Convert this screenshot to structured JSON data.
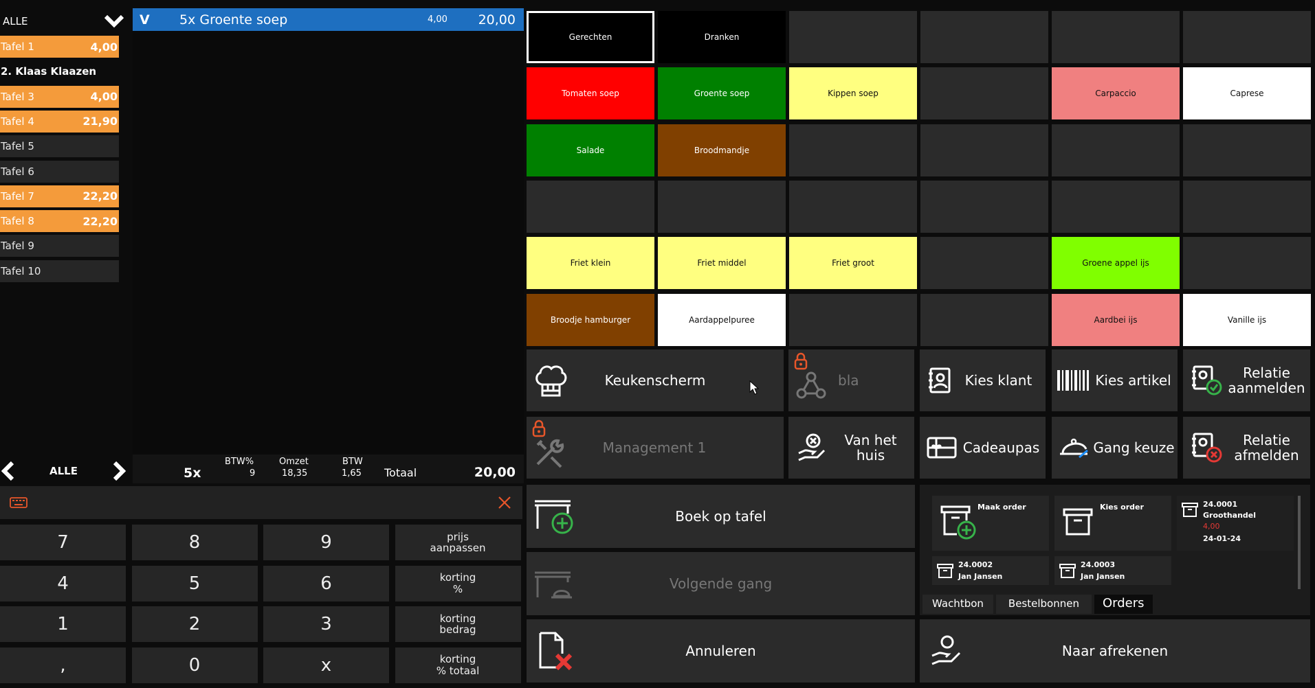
{
  "tables": {
    "filter_label": "ALLE",
    "items": [
      {
        "name": "Tafel 1",
        "amount": "4,00",
        "state": "busy"
      },
      {
        "name": "2. Klaas Klaazen",
        "amount": "",
        "state": "bold"
      },
      {
        "name": "Tafel 3",
        "amount": "4,00",
        "state": "busy"
      },
      {
        "name": "Tafel 4",
        "amount": "21,90",
        "state": "busy"
      },
      {
        "name": "Tafel 5",
        "amount": "",
        "state": "free"
      },
      {
        "name": "Tafel 6",
        "amount": "",
        "state": "free"
      },
      {
        "name": "Tafel 7",
        "amount": "22,20",
        "state": "busy"
      },
      {
        "name": "Tafel 8",
        "amount": "22,20",
        "state": "busy"
      },
      {
        "name": "Tafel 9",
        "amount": "",
        "state": "free"
      },
      {
        "name": "Tafel 10",
        "amount": "",
        "state": "free"
      }
    ],
    "pager_label": "ALLE"
  },
  "order": {
    "line": {
      "flag": "V",
      "text": "5x Groente soep",
      "unit": "4,00",
      "total": "20,00"
    },
    "summary": {
      "count": "5x",
      "btw_pct_label": "BTW%",
      "btw_pct": "9",
      "omzet_label": "Omzet",
      "omzet": "18,35",
      "btw_label": "BTW",
      "btw": "1,65",
      "totaal_label": "Totaal",
      "totaal": "20,00"
    }
  },
  "keypad": {
    "keys": [
      "7",
      "8",
      "9",
      "4",
      "5",
      "6",
      "1",
      "2",
      "3",
      ",",
      "0",
      "x"
    ],
    "side": [
      "prijs\naanpassen",
      "korting\n%",
      "korting\nbedrag",
      "korting\n% totaal"
    ]
  },
  "products": [
    {
      "label": "Gerechten",
      "color": "#000000"
    },
    {
      "label": "Dranken",
      "color": "#000000"
    },
    {
      "label": "",
      "color": "#2b2b2b"
    },
    {
      "label": "",
      "color": "#2b2b2b"
    },
    {
      "label": "",
      "color": "#2b2b2b"
    },
    {
      "label": "",
      "color": "#2b2b2b"
    },
    {
      "label": "Tomaten soep",
      "color": "#ff0000"
    },
    {
      "label": "Groente soep",
      "color": "#008000"
    },
    {
      "label": "Kippen soep",
      "color": "#ffff80"
    },
    {
      "label": "",
      "color": "#2b2b2b"
    },
    {
      "label": "Carpaccio",
      "color": "#f08080"
    },
    {
      "label": "Caprese",
      "color": "#ffffff"
    },
    {
      "label": "Salade",
      "color": "#008000"
    },
    {
      "label": "Broodmandje",
      "color": "#804000"
    },
    {
      "label": "",
      "color": "#2b2b2b"
    },
    {
      "label": "",
      "color": "#2b2b2b"
    },
    {
      "label": "",
      "color": "#2b2b2b"
    },
    {
      "label": "",
      "color": "#2b2b2b"
    },
    {
      "label": "",
      "color": "#2b2b2b"
    },
    {
      "label": "",
      "color": "#2b2b2b"
    },
    {
      "label": "",
      "color": "#2b2b2b"
    },
    {
      "label": "",
      "color": "#2b2b2b"
    },
    {
      "label": "",
      "color": "#2b2b2b"
    },
    {
      "label": "",
      "color": "#2b2b2b"
    },
    {
      "label": "Friet klein",
      "color": "#ffff80"
    },
    {
      "label": "Friet middel",
      "color": "#ffff80"
    },
    {
      "label": "Friet groot",
      "color": "#ffff80"
    },
    {
      "label": "",
      "color": "#2b2b2b"
    },
    {
      "label": "Groene appel ijs",
      "color": "#80ff00"
    },
    {
      "label": "",
      "color": "#2b2b2b"
    },
    {
      "label": "Broodje hamburger",
      "color": "#804000"
    },
    {
      "label": "Aardappelpuree",
      "color": "#ffffff"
    },
    {
      "label": "",
      "color": "#2b2b2b"
    },
    {
      "label": "",
      "color": "#2b2b2b"
    },
    {
      "label": "Aardbei ijs",
      "color": "#f08080"
    },
    {
      "label": "Vanille ijs",
      "color": "#ffffff"
    }
  ],
  "actions": {
    "keukenscherm": "Keukenscherm",
    "bla": "bla",
    "kies_klant": "Kies klant",
    "kies_artikel": "Kies artikel",
    "relatie_aanmelden": "Relatie\naanmelden",
    "management": "Management 1",
    "van_het_huis": "Van het\nhuis",
    "cadeaupas": "Cadeaupas",
    "gang_keuze": "Gang keuze",
    "relatie_afmelden": "Relatie\nafmelden",
    "boek_op_tafel": "Boek op tafel",
    "volgende_gang": "Volgende gang",
    "annuleren": "Annuleren",
    "naar_afrekenen": "Naar afrekenen"
  },
  "orders_panel": {
    "maak_order": "Maak order",
    "kies_order": "Kies order",
    "orders": [
      {
        "id": "24.0001",
        "name": "Groothandel",
        "amount": "4,00",
        "date": "24-01-24"
      },
      {
        "id": "24.0002",
        "name": "Jan Jansen"
      },
      {
        "id": "24.0003",
        "name": "Jan Jansen"
      }
    ],
    "tabs": [
      "Wachtbon",
      "Bestelbonnen",
      "Orders"
    ]
  },
  "colors": {
    "busy": "#f49b3b",
    "selected": "#1e6fc0",
    "tile": "#2b2b2b",
    "lock": "#e8562a",
    "plus": "#37b34a",
    "cross": "#e53935"
  }
}
